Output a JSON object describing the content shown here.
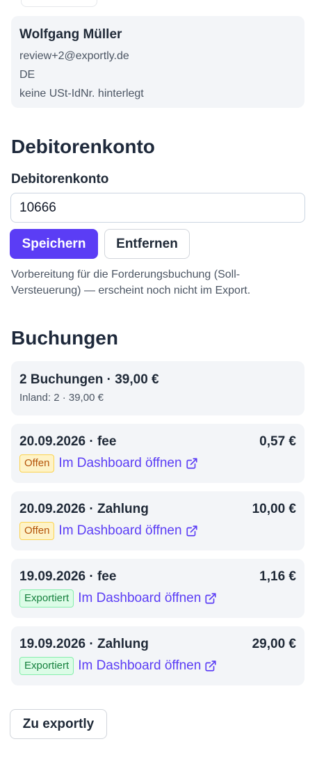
{
  "contact": {
    "name": "Wolfgang Müller",
    "email": "review+2@exportly.de",
    "country": "DE",
    "vat": "keine USt-IdNr. hinterlegt"
  },
  "debitor": {
    "heading": "Debitorenkonto",
    "label": "Debitorenkonto",
    "value": "10666",
    "save_label": "Speichern",
    "remove_label": "Entfernen",
    "help": "Vorbereitung für die Forderungsbuchung (Soll-Versteuerung) — erscheint noch nicht im Export."
  },
  "buchungen": {
    "heading": "Buchungen",
    "summary_title": "2 Buchungen · 39,00 €",
    "summary_sub": "Inland: 2 · 39,00 €",
    "link_label": "Im Dashboard öffnen",
    "items": [
      {
        "title": "20.09.2026 · fee",
        "amount": "0,57 €",
        "status": "Offen"
      },
      {
        "title": "20.09.2026 · Zahlung",
        "amount": "10,00 €",
        "status": "Offen"
      },
      {
        "title": "19.09.2026 · fee",
        "amount": "1,16 €",
        "status": "Exportiert"
      },
      {
        "title": "19.09.2026 · Zahlung",
        "amount": "29,00 €",
        "status": "Exportiert"
      }
    ]
  },
  "footer": {
    "back_label": "Zu exportly"
  },
  "colors": {
    "accent": "#5b3df5",
    "card": "#f3f5f8",
    "open": "#fef3c7",
    "exported": "#dcfce7"
  }
}
